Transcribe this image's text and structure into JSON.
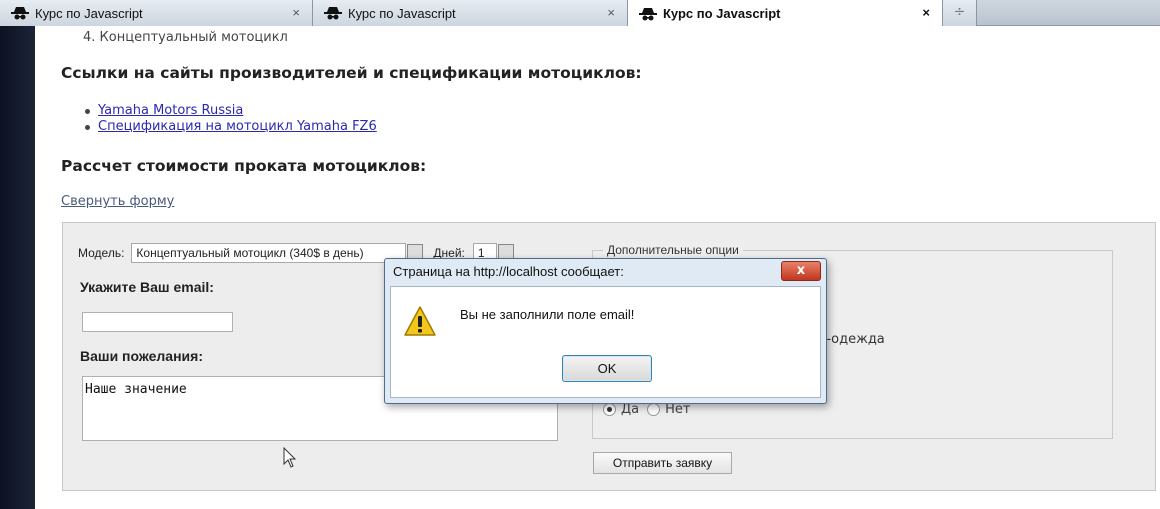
{
  "tabs": [
    {
      "title": "Курс по Javascript",
      "close": "×"
    },
    {
      "title": "Курс по Javascript",
      "close": "×"
    },
    {
      "title": "Курс по Javascript",
      "close": "×"
    }
  ],
  "new_tab": "÷",
  "page": {
    "list_item": "4.  Концептуальный мотоцикл",
    "links_heading": "Ссылки на сайты производителей и спецификации мотоциклов:",
    "links": [
      "Yamaha Motors Russia",
      "Спецификация на мотоцикл Yamaha FZ6"
    ],
    "calc_heading": "Рассчет стоимости проката мотоциклов:",
    "collapse_link": "Свернуть форму"
  },
  "form": {
    "model_label": "Модель:",
    "model_value": "Концептуальный мотоцикл (340$ в день)",
    "days_label": "Дней:",
    "days_value": "1",
    "email_label": "Укажите Ваш email:",
    "email_value": "",
    "wishes_label": "Ваши пожелания:",
    "wishes_value": "Наше значение",
    "options_legend": "Дополнительные опции",
    "moto_clothing_fragment": "ото-одежда",
    "radio_yes": "Да",
    "radio_no": "Нет",
    "submit_label": "Отправить заявку"
  },
  "dialog": {
    "title": "Страница на http://localhost сообщает:",
    "close": "x",
    "message": "Вы не заполнили поле email!",
    "ok": "OK"
  },
  "colors": {
    "accent_link": "#2a2ab0",
    "close_button": "#c1371d"
  }
}
